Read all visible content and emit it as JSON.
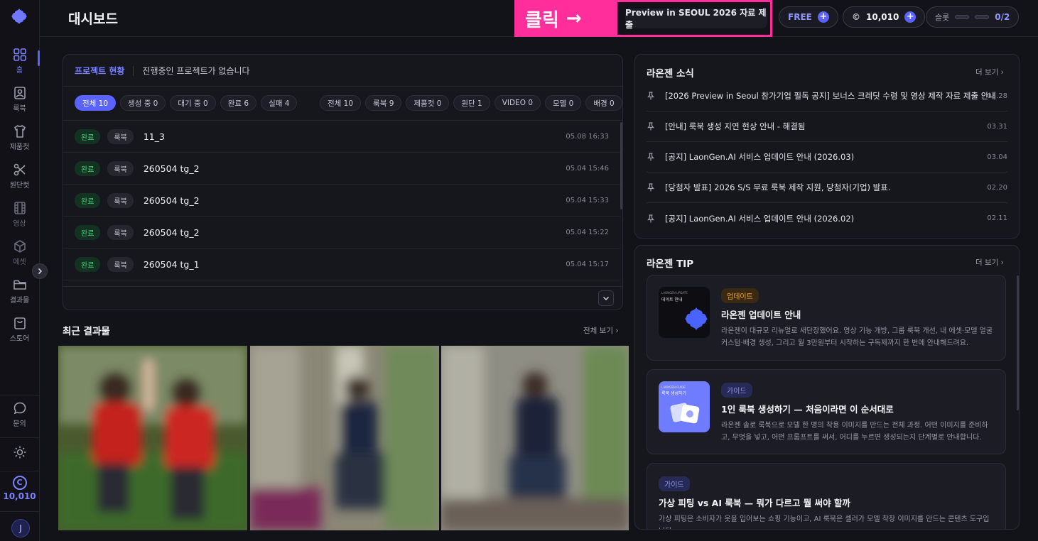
{
  "sidebar": {
    "items": [
      {
        "label": "홈",
        "icon": "grid-icon"
      },
      {
        "label": "룩북",
        "icon": "image-icon"
      },
      {
        "label": "제품컷",
        "icon": "shirt-icon"
      },
      {
        "label": "원단컷",
        "icon": "scissors-icon"
      },
      {
        "label": "영상",
        "icon": "film-icon"
      },
      {
        "label": "에셋",
        "icon": "cube-icon"
      },
      {
        "label": "결과물",
        "icon": "folder-icon"
      },
      {
        "label": "스토어",
        "icon": "bag-icon"
      }
    ],
    "help_label": "문의",
    "credits": "10,010",
    "credit_symbol": "C",
    "avatar_initial": "J"
  },
  "header": {
    "title": "대시보드",
    "annotation_label": "클릭",
    "annotation_arrow": "→",
    "preview_button": "Preview in SEOUL 2026 자료 제출",
    "plan_label": "FREE",
    "credits_value": "10,010",
    "credit_symbol": "©",
    "slot_label": "슬롯",
    "slot_value": "0/2",
    "plus": "+"
  },
  "projects": {
    "tab_label": "프로젝트 현황",
    "empty_text": "진행중인 프로젝트가 없습니다",
    "status_filters": [
      "전체 10",
      "생성 중 0",
      "대기 중 0",
      "완료 6",
      "실패 4"
    ],
    "type_filters": [
      "전체 10",
      "룩북 9",
      "제품컷 0",
      "원단 1",
      "VIDEO 0",
      "모델 0",
      "배경 0"
    ],
    "rows": [
      {
        "status": "완료",
        "type": "룩북",
        "name": "11_3",
        "time": "05.08 16:33"
      },
      {
        "status": "완료",
        "type": "룩북",
        "name": "260504 tg_2",
        "time": "05.04 15:46"
      },
      {
        "status": "완료",
        "type": "룩북",
        "name": "260504 tg_2",
        "time": "05.04 15:33"
      },
      {
        "status": "완료",
        "type": "룩북",
        "name": "260504 tg_2",
        "time": "05.04 15:22"
      },
      {
        "status": "완료",
        "type": "룩북",
        "name": "260504 tg_1",
        "time": "05.04 15:17"
      }
    ]
  },
  "recent": {
    "title": "최근 결과물",
    "more": "전체 보기 ›"
  },
  "news": {
    "title": "라온젠 소식",
    "more": "더 보기 ›",
    "items": [
      {
        "text": "[2026 Preview in Seoul 참가기업 필독 공지] 보너스 크레딧 수령 및 영상 제작 자료 제출 안내",
        "date": "05.28"
      },
      {
        "text": "[안내] 룩북 생성 지연 현상 안내 - 해결됨",
        "date": "03.31"
      },
      {
        "text": "[공지] LaonGen.AI 서비스 업데이트 안내 (2026.03)",
        "date": "03.04"
      },
      {
        "text": "[당첨자 발표] 2026 S/S 무료 룩북 제작 지원, 당첨자(기업) 발표.",
        "date": "02.20"
      },
      {
        "text": "[공지] LaonGen.AI 서비스 업데이트 안내 (2026.02)",
        "date": "02.11"
      }
    ]
  },
  "tips": {
    "title": "라온젠 TIP",
    "more": "더 보기 ›",
    "cards": [
      {
        "badge": "업데이트",
        "title": "라온젠 업데이트 안내",
        "desc": "라온젠이 대규모 리뉴얼로 새단장했어요. 영상 기능 개방, 그룹 룩북 개선, 내 에셋·모델 얼굴 커스텀·배경 생성, 그리고 월 3만원부터 시작하는 구독제까지 한 번에 안내해드려요.",
        "thumb_small": "LAONGEN UPDATE",
        "thumb_text": "데이트 안내"
      },
      {
        "badge": "가이드",
        "title": "1인 룩북 생성하기 — 처음이라면 이 순서대로",
        "desc": "라온젠 솔로 룩북으로 모델 한 명의 착용 이미지를 만드는 전체 과정. 어떤 이미지를 준비하고, 무엇을 넣고, 어떤 프롬프트를 써서, 어디를 누르면 생성되는지 단계별로 안내합니다.",
        "thumb_small": "LAONGEN GUIDE",
        "thumb_text": "룩북 생성하기"
      },
      {
        "badge": "가이드",
        "title": "가상 피팅 vs AI 룩북 — 뭐가 다르고 뭘 써야 할까",
        "desc": "가상 피팅은 소비자가 옷을 입어보는 쇼핑 기능이고, AI 룩북은 셀러가 모델 착장 이미지를 만드는 콘텐츠 도구입니다."
      }
    ]
  },
  "colors": {
    "accent": "#5b63ff",
    "annotation": "#ff2e9a",
    "success": "#3fd07a",
    "update_badge": "#e8a23a",
    "guide_badge": "#8f95ff"
  }
}
